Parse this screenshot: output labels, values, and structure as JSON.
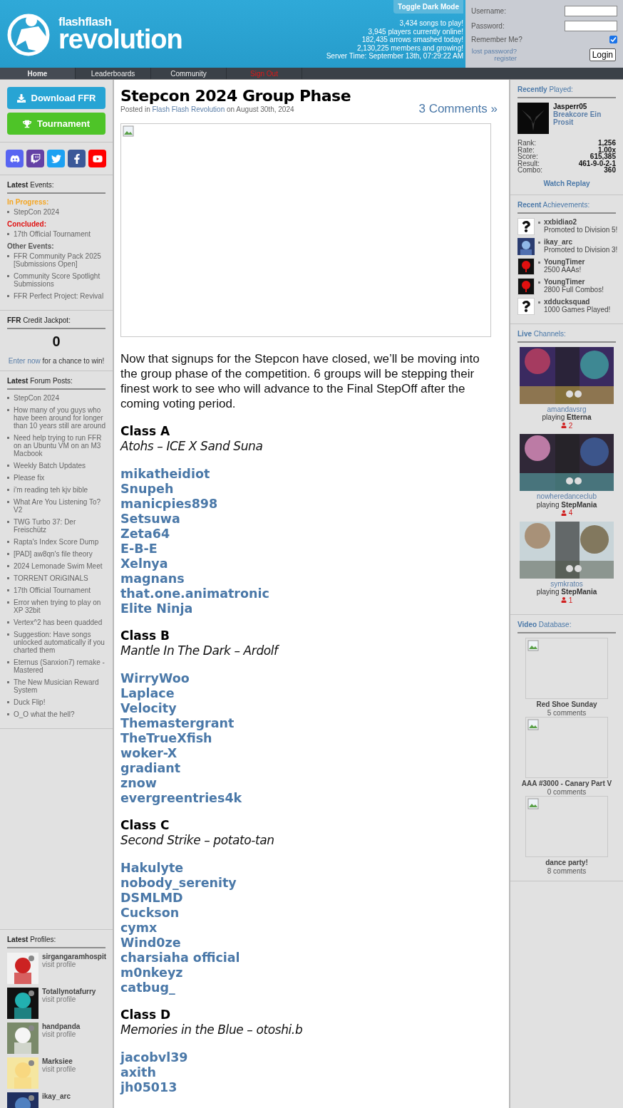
{
  "header": {
    "logo": {
      "line1": "flashflash",
      "line2": "revolution"
    },
    "toggle_button": "Toggle Dark Mode",
    "stats": [
      "3,434 songs to play!",
      "3,945 players currently online!",
      "182,435 arrows smashed today!",
      "2,130,225 members and growing!",
      "Server Time: September 13th, 07:29:22 AM"
    ],
    "login": {
      "username_label": "Username:",
      "password_label": "Password:",
      "remember_label": "Remember Me?",
      "remember_checked": true,
      "lost_password": "lost password?",
      "register": "register",
      "login_button": "Login"
    }
  },
  "nav": [
    {
      "label": "Home",
      "selected": true,
      "kind": "normal"
    },
    {
      "label": "Leaderboards",
      "selected": false,
      "kind": "normal"
    },
    {
      "label": "Community",
      "selected": false,
      "kind": "normal"
    },
    {
      "label": "Sign Out",
      "selected": false,
      "kind": "danger"
    }
  ],
  "left": {
    "buttons": [
      {
        "label": "Download FFR",
        "kind": "download"
      },
      {
        "label": "Tournament",
        "kind": "tournament"
      }
    ],
    "social": [
      {
        "kind": "discord"
      },
      {
        "kind": "twitch"
      },
      {
        "kind": "twitter"
      },
      {
        "kind": "facebook"
      },
      {
        "kind": "youtube"
      }
    ],
    "events": {
      "title": "**Latest** Events:",
      "groups": [
        {
          "label": "In Progress:",
          "color": "#f5a623",
          "items": [
            "StepCon 2024"
          ]
        },
        {
          "label": "Concluded:",
          "color": "#e01010",
          "items": [
            "17th Official Tournament"
          ]
        },
        {
          "label": "Other Events:",
          "color": "#555555",
          "items": [
            "FFR Community Pack 2025 [Submissions Open]",
            "Community Score Spotlight Submissions",
            "FFR Perfect Project: Revival"
          ]
        }
      ]
    },
    "jackpot": {
      "title": "**FFR** Credit Jackpot:",
      "value": "0",
      "link": "Enter now",
      "text": "for a chance to win!"
    },
    "forum": {
      "title": "**Latest** Forum Posts:",
      "items": [
        "StepCon 2024",
        "How many of you guys who have been around for longer than 10 years still are around",
        "Need help trying to run FFR on an Ubuntu VM on an M3 Macbook",
        "Weekly Batch Updates",
        "Please fix",
        "i'm reading teh kjv bible",
        "What Are You Listening To? V2",
        "TWG Turbo 37: Der Freischütz",
        "Rapta's Index Score Dump",
        "[PAD] aw8qn's file theory",
        "2024 Lemonade Swim Meet",
        "TORRENT ORiGINALS",
        "17th Official Tournament",
        "Error when trying to play on XP 32bit",
        "Vertex^2 has been quadded",
        "Suggestion: Have songs unlocked automatically if you charted them",
        "Eternus (Sanxion7) remake - Mastered",
        "The New Musician Reward System",
        "Duck Flip!",
        "O_O what the hell?"
      ]
    },
    "profiles": {
      "title": "**Latest** Profiles:",
      "items": [
        {
          "name": "sirgangaramhospit",
          "link": "visit profile"
        },
        {
          "name": "Totallynotafurry",
          "link": "visit profile"
        },
        {
          "name": "handpanda",
          "link": "visit profile"
        },
        {
          "name": "Marksiee",
          "link": "visit profile"
        },
        {
          "name": "ikay_arc"
        }
      ]
    }
  },
  "main": {
    "title": "Stepcon 2024 Group Phase",
    "meta": {
      "prefix": "Posted in",
      "link": "Flash Flash Revolution",
      "suffix": "on August 30th, 2024"
    },
    "comments": "3 Comments »",
    "intro": "Now that signups for the Stepcon have closed, we’ll be moving into the group phase of the competition. 6 groups will be stepping their finest work to see who will advance to the Final StepOff after the coming voting period.",
    "classes": [
      {
        "title": "Class A",
        "song": "Atohs – ICE X Sand Suna",
        "players": [
          "mikatheidiot",
          "Snupeh",
          "manicpies898",
          "Setsuwa",
          "Zeta64",
          "E-B-E",
          "Xelnya",
          "magnans",
          "that.one.animatronic",
          "Elite Ninja"
        ]
      },
      {
        "title": "Class B",
        "song": "Mantle In The Dark – Ardolf",
        "players": [
          "WirryWoo",
          "Laplace",
          "Velocity",
          "Themastergrant",
          "TheTrueXfish",
          "woker-X",
          "gradiant",
          "znow",
          "evergreentries4k"
        ]
      },
      {
        "title": "Class C",
        "song": "Second Strike – potato-tan",
        "players": [
          "Hakulyte",
          "nobody_serenity",
          "DSMLMD",
          "Cuckson",
          "cymx",
          "Wind0ze",
          "charsiaha official",
          "m0nkeyz",
          "catbug_"
        ]
      },
      {
        "title": "Class D",
        "song": "Memories in the Blue – otoshi.b",
        "players": [
          "jacobvl39",
          "axith",
          "jh05013"
        ]
      }
    ]
  },
  "right": {
    "recent": {
      "title": "**Recently** Played:",
      "player": "Jasperr05",
      "song": "Breakcore Ein Prosit",
      "stats": [
        {
          "label": "Rank:",
          "value": "1,256"
        },
        {
          "label": "Rate:",
          "value": "1.00x"
        },
        {
          "label": "Score:",
          "value": "615,385"
        },
        {
          "label": "Result:",
          "value": "461-9-0-2-1"
        },
        {
          "label": "Combo:",
          "value": "360"
        }
      ],
      "replay": "Watch Replay"
    },
    "achievements": {
      "title": "**Recent** Achievements:",
      "items": [
        {
          "name": "xxbidiao2",
          "text": "Promoted to Division 5!",
          "kind": "unknown"
        },
        {
          "name": "ikay_arc",
          "text": "Promoted to Division 3!"
        },
        {
          "name": "YoungTimer",
          "text": "2500 AAAs!",
          "kind": "tree"
        },
        {
          "name": "YoungTimer",
          "text": "2800 Full Combos!",
          "kind": "tree"
        },
        {
          "name": "xdducksquad",
          "text": "1000 Games Played!",
          "kind": "unknown"
        }
      ]
    },
    "live": {
      "title": "**Live** Channels:",
      "channels": [
        {
          "user": "amandavsrg",
          "playing": "playing **Etterna**",
          "viewers": "2"
        },
        {
          "user": "nowheredanceclub",
          "playing": "playing **StepMania**",
          "viewers": "4"
        },
        {
          "user": "symkratos",
          "playing": "playing **StepMania**",
          "viewers": "1"
        }
      ]
    },
    "videos": {
      "title": "**Video** Database:",
      "items": [
        {
          "title": "Red Shoe Sunday",
          "comments": "5 comments"
        },
        {
          "title": "AAA #3000 - Canary Part V",
          "comments": "0 comments"
        },
        {
          "title": "dance party!",
          "comments": "8 comments"
        }
      ]
    }
  }
}
